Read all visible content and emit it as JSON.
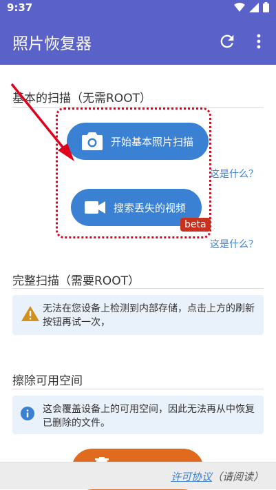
{
  "status_bar": {
    "time": "9:37",
    "icons": [
      "wifi-icon",
      "signal-icon",
      "battery-icon"
    ]
  },
  "app_bar": {
    "title": "照片恢复器",
    "refresh_icon": "refresh-icon",
    "menu_icon": "more-vert-icon"
  },
  "basic_scan": {
    "title": "基本的扫描（无需ROOT）",
    "photo_button": {
      "label": "开始基本照片扫描",
      "icon": "camera-icon"
    },
    "photo_help": "这是什么？",
    "video_button": {
      "label": "搜索丢失的视频",
      "icon": "video-camera-icon",
      "badge": "beta"
    },
    "video_help": "这是什么？"
  },
  "full_scan": {
    "title": "完整扫描（需要ROOT）",
    "warning": {
      "icon": "warning-icon",
      "text": "无法在您设备上检测到内部存储，点击上方的刷新按钮再试一次，"
    }
  },
  "wipe": {
    "title": "擦除可用空间",
    "info": {
      "icon": "info-icon",
      "text": "这会覆盖设备上的可用空间，因此无法再从中恢复已删除的文件。"
    },
    "button_icon": "trash-icon"
  },
  "footer": {
    "license_link": "许可协议",
    "license_note": "（请阅读）"
  },
  "colors": {
    "primary": "#5a61c9",
    "button_blue": "#3a80d3",
    "beta_red": "#c8311e",
    "highlight_red": "#e0001b",
    "orange": "#e06a1e"
  }
}
